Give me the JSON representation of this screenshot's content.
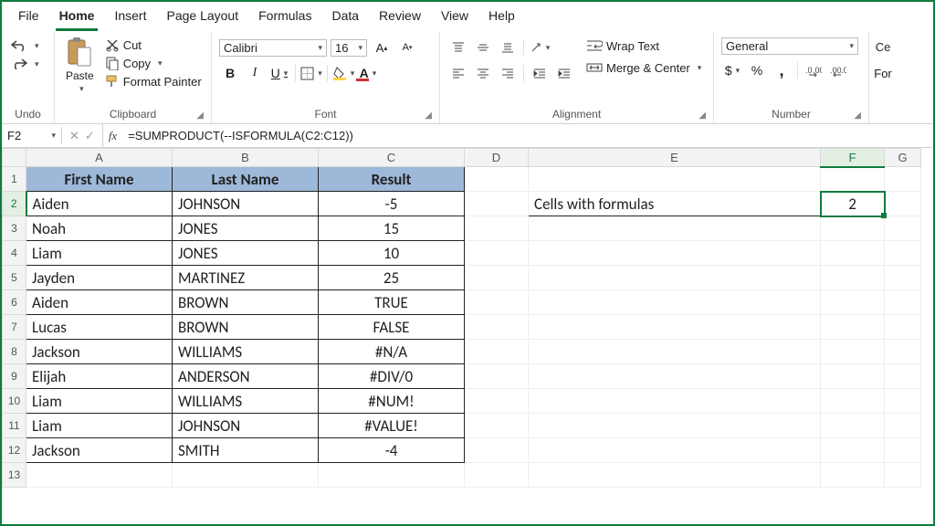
{
  "menu": {
    "items": [
      "File",
      "Home",
      "Insert",
      "Page Layout",
      "Formulas",
      "Data",
      "Review",
      "View",
      "Help"
    ],
    "active": 1
  },
  "ribbon": {
    "undo": {
      "label": "Undo"
    },
    "clipboard": {
      "label": "Clipboard",
      "paste": "Paste",
      "cut": "Cut",
      "copy": "Copy",
      "fmt": "Format Painter"
    },
    "font": {
      "label": "Font",
      "name": "Calibri",
      "size": "16"
    },
    "alignment": {
      "label": "Alignment",
      "wrap": "Wrap Text",
      "merge": "Merge & Center"
    },
    "number": {
      "label": "Number",
      "format": "General"
    },
    "cells_partial": "Ce",
    "format_partial": "For"
  },
  "formula_bar": {
    "cell_ref": "F2",
    "formula": "=SUMPRODUCT(--ISFORMULA(C2:C12))"
  },
  "columns": [
    "A",
    "B",
    "C",
    "D",
    "E",
    "F",
    "G"
  ],
  "active_cell": {
    "row": 2,
    "col": "F"
  },
  "data_table": {
    "headers": [
      "First Name",
      "Last Name",
      "Result"
    ],
    "rows": [
      [
        "Aiden",
        "JOHNSON",
        "-5"
      ],
      [
        "Noah",
        "JONES",
        "15"
      ],
      [
        "Liam",
        "JONES",
        "10"
      ],
      [
        "Jayden",
        "MARTINEZ",
        "25"
      ],
      [
        "Aiden",
        "BROWN",
        "TRUE"
      ],
      [
        "Lucas",
        "BROWN",
        "FALSE"
      ],
      [
        "Jackson",
        "WILLIAMS",
        "#N/A"
      ],
      [
        "Elijah",
        "ANDERSON",
        "#DIV/0"
      ],
      [
        "Liam",
        "WILLIAMS",
        "#NUM!"
      ],
      [
        "Liam",
        "JOHNSON",
        "#VALUE!"
      ],
      [
        "Jackson",
        "SMITH",
        "-4"
      ]
    ]
  },
  "summary": {
    "label": "Cells with formulas",
    "value": "2"
  },
  "chart_data": {
    "type": "table",
    "title": "",
    "columns": [
      "First Name",
      "Last Name",
      "Result"
    ],
    "rows": [
      [
        "Aiden",
        "JOHNSON",
        "-5"
      ],
      [
        "Noah",
        "JONES",
        "15"
      ],
      [
        "Liam",
        "JONES",
        "10"
      ],
      [
        "Jayden",
        "MARTINEZ",
        "25"
      ],
      [
        "Aiden",
        "BROWN",
        "TRUE"
      ],
      [
        "Lucas",
        "BROWN",
        "FALSE"
      ],
      [
        "Jackson",
        "WILLIAMS",
        "#N/A"
      ],
      [
        "Elijah",
        "ANDERSON",
        "#DIV/0"
      ],
      [
        "Liam",
        "WILLIAMS",
        "#NUM!"
      ],
      [
        "Liam",
        "JOHNSON",
        "#VALUE!"
      ],
      [
        "Jackson",
        "SMITH",
        "-4"
      ]
    ],
    "aux": {
      "E2": "Cells with formulas",
      "F2": 2
    }
  }
}
